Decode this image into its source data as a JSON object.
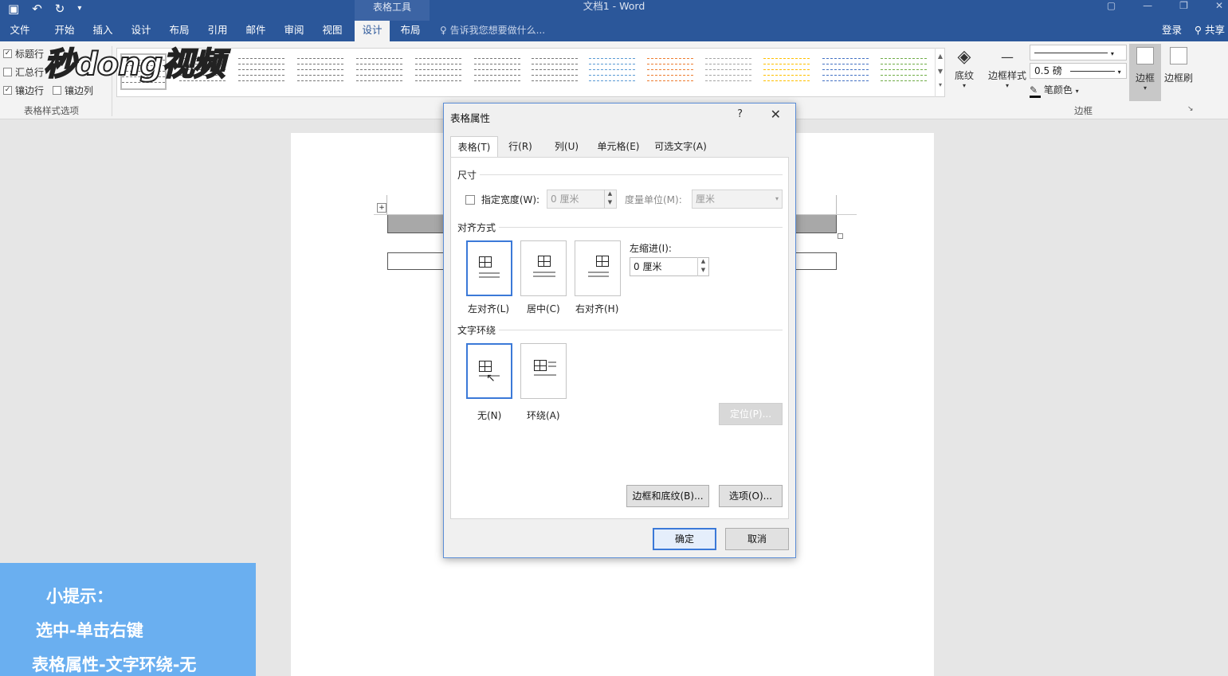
{
  "titlebar": {
    "table_tools": "表格工具",
    "doc_title": "文档1 - Word"
  },
  "menu": {
    "tabs": [
      "文件",
      "开始",
      "插入",
      "设计",
      "布局",
      "引用",
      "邮件",
      "审阅",
      "视图",
      "设计",
      "布局"
    ],
    "active_index": 9,
    "tell_me": "告诉我您想要做什么...",
    "login": "登录",
    "share": "共享"
  },
  "ribbon": {
    "style_options": {
      "header_row": "标题行",
      "total_row": "汇总行",
      "banded_rows": "镶边行",
      "banded_cols": "镶边列",
      "group_label": "表格样式选项"
    },
    "shading": "底纹",
    "border_styles": "边框样式",
    "pen_weight": "0.5 磅",
    "pen_color": "笔颜色",
    "borders": "边框",
    "border_painter": "边框刷",
    "borders_group": "边框"
  },
  "logo_text": "秒dong视频",
  "tip": {
    "line1": "小提示：",
    "line2": "选中-单击右键",
    "line3": "表格属性-文字环绕-无"
  },
  "dialog": {
    "title": "表格属性",
    "help": "?",
    "close": "✕",
    "tabs": [
      "表格(T)",
      "行(R)",
      "列(U)",
      "单元格(E)",
      "可选文字(A)"
    ],
    "size": {
      "section": "尺寸",
      "preferred_width_label": "指定宽度(W):",
      "width_value": "0 厘米",
      "measure_label": "度量单位(M):",
      "measure_value": "厘米"
    },
    "alignment": {
      "section": "对齐方式",
      "left": "左对齐(L)",
      "center": "居中(C)",
      "right": "右对齐(H)",
      "indent_label": "左缩进(I):",
      "indent_value": "0 厘米"
    },
    "wrapping": {
      "section": "文字环绕",
      "none": "无(N)",
      "around": "环绕(A)",
      "positioning": "定位(P)..."
    },
    "borders_shading": "边框和底纹(B)...",
    "options": "选项(O)...",
    "ok": "确定",
    "cancel": "取消"
  }
}
